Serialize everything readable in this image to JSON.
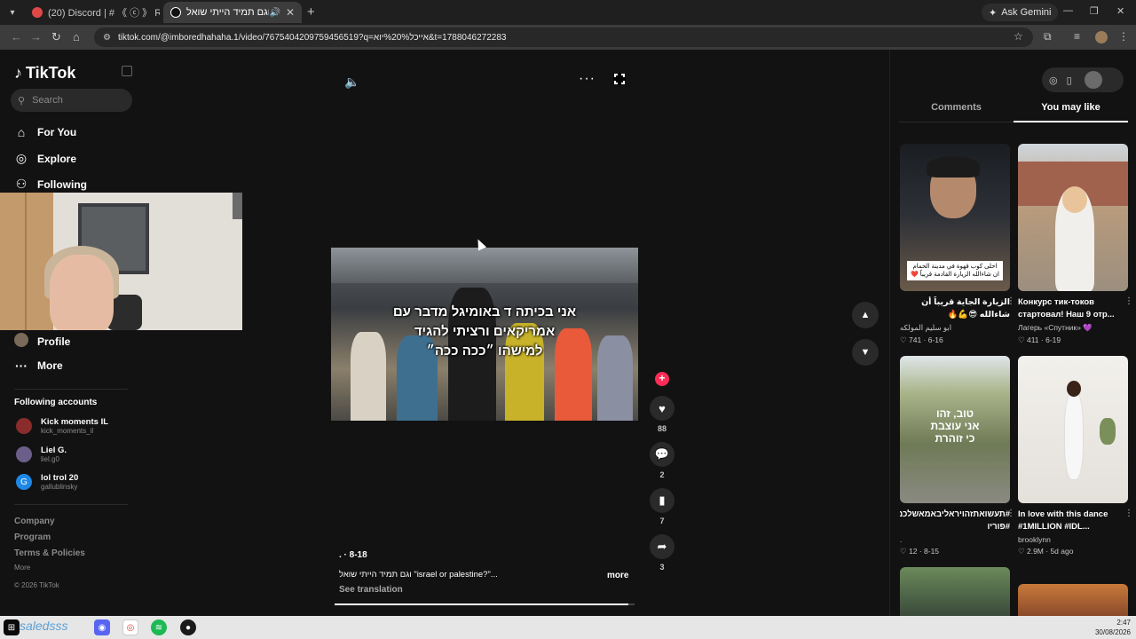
{
  "browser": {
    "tabs": [
      {
        "title": "(20) Discord | # 《 ⓒ 》 React-tr"
      },
      {
        "title": "וגם תמיד הייתי שואל \"israel or palestine\"",
        "active": true
      }
    ],
    "new_tab": "+",
    "ask_gemini": "Ask Gemini",
    "url": "tiktok.com/@imboredhahaha.1/video/7675404209759456519?q=אייכל%20%יוא&t=1788046272283"
  },
  "sidebar": {
    "brand": "TikTok",
    "search_placeholder": "Search",
    "nav": [
      {
        "label": "For You",
        "icon": "home-icon"
      },
      {
        "label": "Explore",
        "icon": "compass-icon"
      },
      {
        "label": "Following",
        "icon": "users-icon"
      },
      {
        "label": "Profile",
        "icon": "profile-icon"
      },
      {
        "label": "More",
        "icon": "dots-icon"
      }
    ],
    "following_title": "Following accounts",
    "accounts": [
      {
        "name": "Kick moments IL",
        "handle": "kick_moments_il"
      },
      {
        "name": "Liel G.",
        "handle": "liel.g0"
      },
      {
        "name": "lol trol 20",
        "handle": "gallublinsky",
        "initial": "G"
      }
    ],
    "footer": [
      "Company",
      "Program",
      "Terms & Policies"
    ],
    "footer_more": "More",
    "copyright": "© 2026 TikTok"
  },
  "video": {
    "caption_lines": [
      "אני בכיתה ד באומיגל מדבר עם",
      "אמריקאים ורציתי להגיד",
      "למישהו ״ככה ככה״"
    ],
    "date": ". · 8-18",
    "description": "וגם תמיד הייתי שואל \"israel or palestine?\"...",
    "more": "more",
    "see_translation": "See translation",
    "progress": 0.98,
    "actions": {
      "likes": "88",
      "comments": "2",
      "saves": "7",
      "shares": "3"
    }
  },
  "right_panel": {
    "tabs": [
      {
        "label": "Comments"
      },
      {
        "label": "You may like",
        "active": true
      }
    ],
    "cards": [
      {
        "title": "الزيارة الجاية قريباً أن شاءالله 😎💪🔥 #طروح_وطها...",
        "author": "ابو سليم المولكه",
        "likes": "741",
        "date": "6-16",
        "thumb_caption": "احلى كوب قهوة في مدينة الحمام ان شاءالله الزيارة القادمة قريباً ❤️"
      },
      {
        "title": "Конкурс тик-токов стартовал! Наш 9 отр...",
        "author": "Лагерь «Спутник» 💜",
        "likes": "411",
        "date": "6-19"
      },
      {
        "title": "#תעשואתזהויראליבאמאשלכם #פוריו",
        "author": ".",
        "likes": "12",
        "date": "8-15",
        "thumb_text": "טוב, זהו\nאני עוצבת\nכי זוהרת"
      },
      {
        "title": "In love with this dance #1MILLION #IDL...",
        "author": "brooklynn",
        "likes": "2.9M",
        "date": "5d ago"
      }
    ]
  },
  "taskbar": {
    "search_text": "saledsss",
    "time": "2:47",
    "date": "30/08/2026"
  },
  "colors": {
    "accent": "#fe2c55",
    "background": "#121212"
  }
}
